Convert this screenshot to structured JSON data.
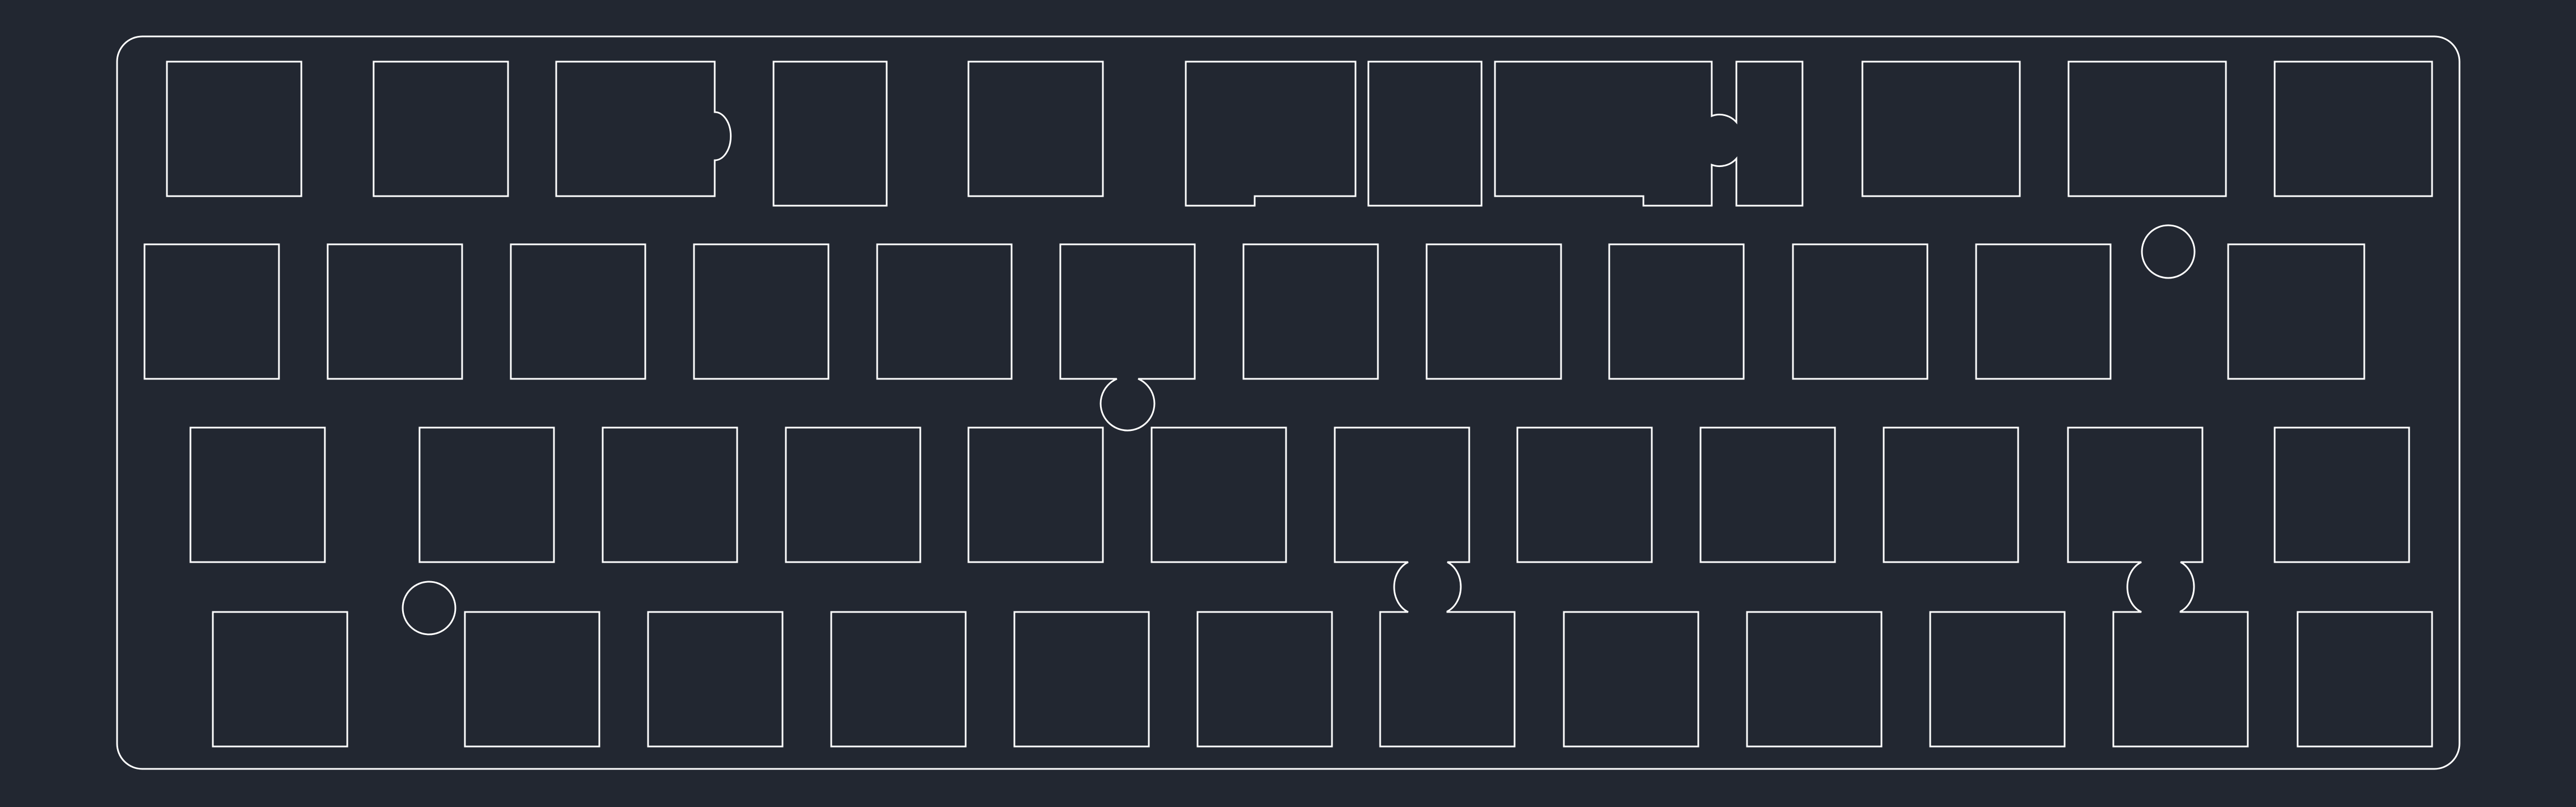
{
  "drawing": {
    "background_color": "#222731",
    "line_color": "#FFFFFF"
  }
}
